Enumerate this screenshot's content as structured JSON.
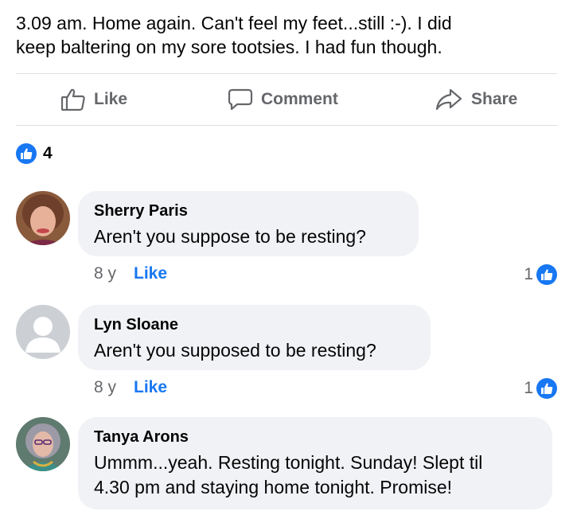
{
  "post": {
    "text": "3.09 am. Home again.  Can't feel my feet...still :-).  I did\nkeep baltering on my sore tootsies.  I had fun though."
  },
  "actions": {
    "like_label": "Like",
    "comment_label": "Comment",
    "share_label": "Share"
  },
  "reactions": {
    "count": "4",
    "icon": "thumbs-up-icon"
  },
  "comments": [
    {
      "author": "Sherry Paris",
      "text": "Aren't you suppose to be resting?",
      "age": "8 y",
      "like_label": "Like",
      "reaction_count": "1"
    },
    {
      "author": "Lyn Sloane",
      "text": "Aren't you supposed to be resting?",
      "age": "8 y",
      "like_label": "Like",
      "reaction_count": "1"
    },
    {
      "author": "Tanya Arons",
      "text": "Ummm...yeah.  Resting tonight. Sunday!  Slept til\n4.30 pm and staying home tonight.  Promise!"
    }
  ],
  "colors": {
    "accent": "#1877f2",
    "bubble": "#f0f2f5",
    "muted": "#65676b"
  }
}
